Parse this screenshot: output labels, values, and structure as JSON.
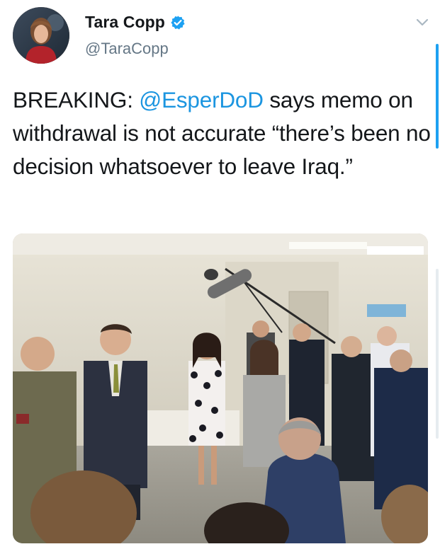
{
  "user": {
    "display_name": "Tara Copp",
    "handle": "@TaraCopp",
    "verified": true
  },
  "tweet": {
    "text_prefix": "BREAKING: ",
    "mention": "@EsperDoD",
    "text_suffix": " says memo on withdrawal is not accurate “there’s been no decision whatsoever to leave Iraq.”"
  },
  "icons": {
    "verified": "verified-badge-icon",
    "menu": "chevron-down-icon"
  },
  "colors": {
    "link": "#1b95e0",
    "verified": "#1da1f2",
    "secondary_text": "#657786"
  },
  "media": {
    "alt_subject": "press-gaggle-photo"
  }
}
